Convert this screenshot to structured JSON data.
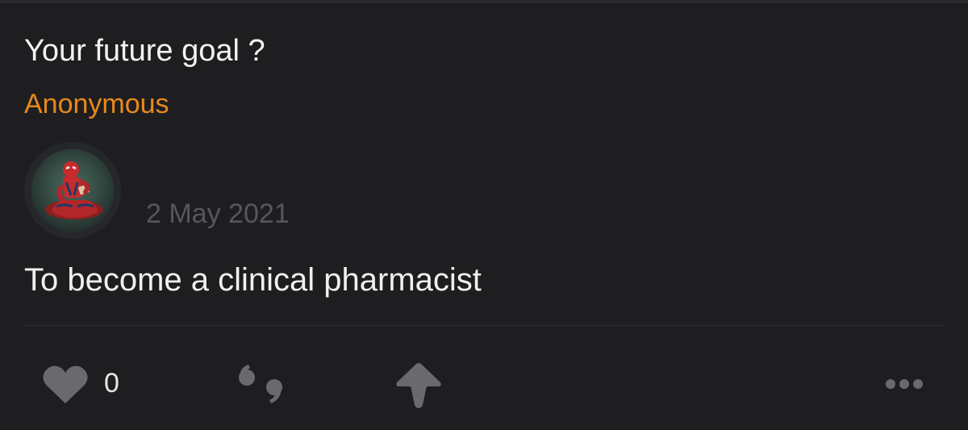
{
  "post": {
    "question": "Your future goal ?",
    "asker": "Anonymous",
    "date": "2 May 2021",
    "answer": "To become a clinical pharmacist"
  },
  "actions": {
    "like_count": "0",
    "like_icon": "heart-icon",
    "quote_icon": "quote-icon",
    "share_icon": "share-icon",
    "more_icon": "more-dots-icon"
  },
  "colors": {
    "background": "#1e1e21",
    "asker": "#e8891a",
    "text": "#f2f2f2",
    "muted": "#57575b",
    "icon": "#6a6a6e"
  }
}
